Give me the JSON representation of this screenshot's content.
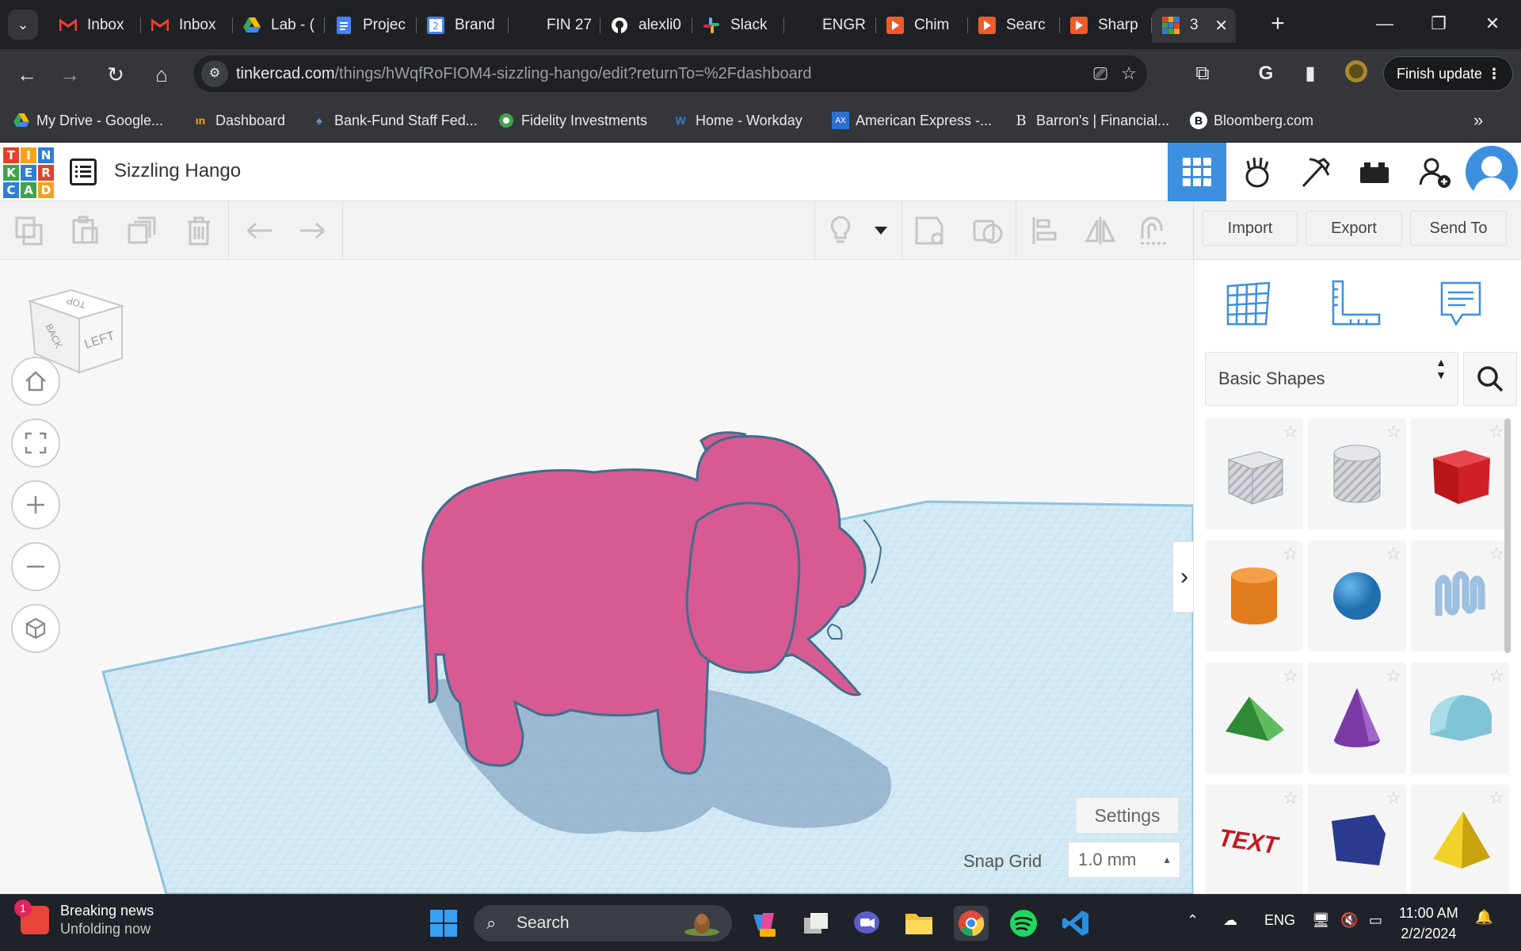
{
  "browser": {
    "tabs": [
      {
        "label": "Inbox",
        "icon": "gmail-icon"
      },
      {
        "label": "Inbox",
        "icon": "gmail-icon"
      },
      {
        "label": "Lab - (",
        "icon": "google-drive-icon"
      },
      {
        "label": "Projec",
        "icon": "google-docs-icon"
      },
      {
        "label": "Brand",
        "icon": "google-calendar-icon"
      },
      {
        "label": "FIN 27",
        "icon": "page-icon"
      },
      {
        "label": "alexli0",
        "icon": "github-icon"
      },
      {
        "label": "Slack",
        "icon": "slack-icon"
      },
      {
        "label": "ENGR",
        "icon": "page-icon"
      },
      {
        "label": "Chim",
        "icon": "app-icon"
      },
      {
        "label": "Searc",
        "icon": "app-icon"
      },
      {
        "label": "Sharp",
        "icon": "app-icon"
      },
      {
        "label": "3",
        "icon": "tinkercad-icon",
        "active": true
      }
    ],
    "url_host": "tinkercad.com",
    "url_path": "/things/hWqfRoFIOM4-sizzling-hango/edit?returnTo=%2Fdashboard",
    "finish_update": "Finish update",
    "bookmarks": [
      {
        "label": "My Drive - Google..."
      },
      {
        "label": "Dashboard"
      },
      {
        "label": "Bank-Fund Staff Fed..."
      },
      {
        "label": "Fidelity Investments"
      },
      {
        "label": "Home - Workday"
      },
      {
        "label": "American Express -..."
      },
      {
        "label": "Barron's | Financial..."
      },
      {
        "label": "Bloomberg.com"
      }
    ]
  },
  "app": {
    "logo_letters": [
      "T",
      "I",
      "N",
      "K",
      "E",
      "R",
      "C",
      "A",
      "D"
    ],
    "project_title": "Sizzling Hango",
    "panel_buttons": {
      "import": "Import",
      "export": "Export",
      "send_to": "Send To"
    },
    "viewcube": {
      "top": "TOP",
      "back": "BACK",
      "left": "LEFT"
    },
    "settings": "Settings",
    "snap_grid_label": "Snap Grid",
    "snap_grid_value": "1.0 mm",
    "shape_category": "Basic Shapes",
    "shapes": [
      {
        "name": "box-hole",
        "color": "#c9ccd3"
      },
      {
        "name": "cylinder-hole",
        "color": "#c9ccd3"
      },
      {
        "name": "box",
        "color": "#d11f26"
      },
      {
        "name": "cylinder",
        "color": "#e88320"
      },
      {
        "name": "sphere",
        "color": "#2d8fd6"
      },
      {
        "name": "scribble",
        "color": "#8fb3d6"
      },
      {
        "name": "roof",
        "color": "#3fa34a"
      },
      {
        "name": "cone",
        "color": "#7a3aa6"
      },
      {
        "name": "round-roof",
        "color": "#7fc3d6"
      },
      {
        "name": "text",
        "color": "#d11f26",
        "label": "TEXT"
      },
      {
        "name": "polygon",
        "color": "#2a3a8f"
      },
      {
        "name": "pyramid",
        "color": "#e8c51a"
      }
    ],
    "model_color": "#d85a92"
  },
  "taskbar": {
    "news_title": "Breaking news",
    "news_sub": "Unfolding now",
    "news_badge": "1",
    "search_placeholder": "Search",
    "lang": "ENG",
    "time": "11:00 AM",
    "date": "2/2/2024"
  }
}
